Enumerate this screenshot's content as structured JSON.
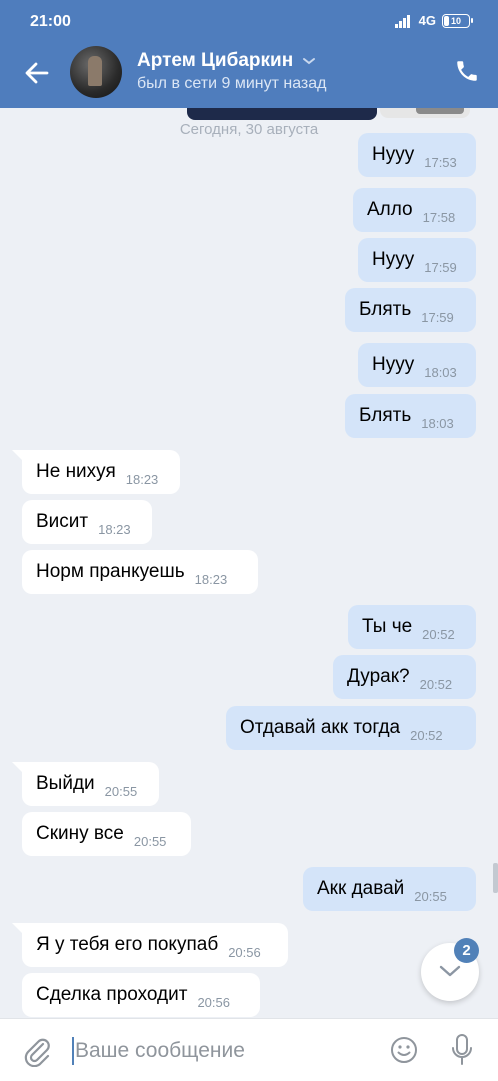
{
  "status_bar": {
    "time": "21:00",
    "network": "4G",
    "battery": "10"
  },
  "header": {
    "name": "Артем Цибаркин",
    "last_seen": "был в сети 9 минут назад"
  },
  "date_separator": "Сегодня, 30 августа",
  "messages": [
    {
      "dir": "out",
      "text": "Нууу",
      "time": "17:53"
    },
    {
      "dir": "out",
      "text": "Алло",
      "time": "17:58"
    },
    {
      "dir": "out",
      "text": "Нууу",
      "time": "17:59"
    },
    {
      "dir": "out",
      "text": "Блять",
      "time": "17:59"
    },
    {
      "dir": "out",
      "text": "Нууу",
      "time": "18:03"
    },
    {
      "dir": "out",
      "text": "Блять",
      "time": "18:03"
    },
    {
      "dir": "in",
      "text": "Не нихуя",
      "time": "18:23"
    },
    {
      "dir": "in",
      "text": "Висит",
      "time": "18:23"
    },
    {
      "dir": "in",
      "text": "Норм пранкуешь",
      "time": "18:23"
    },
    {
      "dir": "out",
      "text": "Ты че",
      "time": "20:52"
    },
    {
      "dir": "out",
      "text": "Дурак?",
      "time": "20:52"
    },
    {
      "dir": "out",
      "text": "Отдавай акк тогда",
      "time": "20:52"
    },
    {
      "dir": "in",
      "text": "Выйди",
      "time": "20:55"
    },
    {
      "dir": "in",
      "text": "Скину все",
      "time": "20:55"
    },
    {
      "dir": "out",
      "text": "Акк давай",
      "time": "20:55"
    },
    {
      "dir": "in",
      "text": "Я у тебя его покупаб",
      "time": "20:56"
    },
    {
      "dir": "in",
      "text": "Сделка проходит",
      "time": "20:56"
    }
  ],
  "unread_badge": "2",
  "composer": {
    "placeholder": "Ваше сообщение"
  },
  "icons": {
    "back": "arrow-left-icon",
    "chevron": "chevron-down-icon",
    "call": "phone-icon",
    "scroll_down": "chevron-down-icon",
    "attach": "paperclip-icon",
    "emoji": "smile-icon",
    "voice": "microphone-icon"
  },
  "colors": {
    "header": "#4f7dbd",
    "background": "#edf0f5",
    "outgoing_bubble": "#d4e4f9",
    "incoming_bubble": "#ffffff",
    "accent": "#5181b8"
  }
}
